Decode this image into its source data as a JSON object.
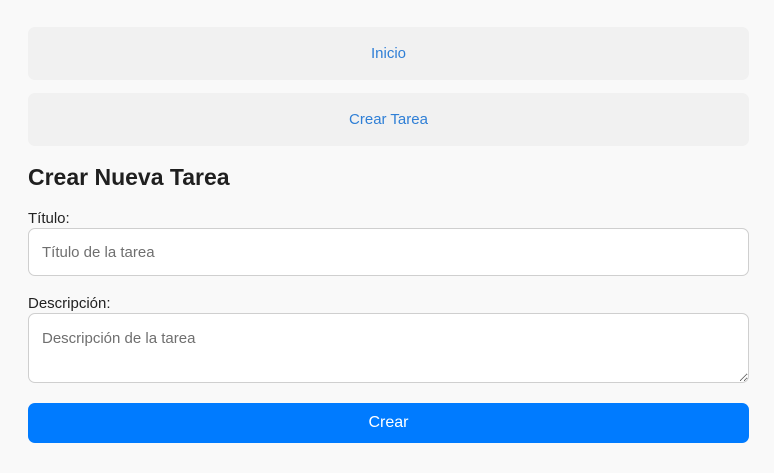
{
  "nav": {
    "home_label": "Inicio",
    "create_label": "Crear Tarea"
  },
  "form": {
    "heading": "Crear Nueva Tarea",
    "title_label": "Título:",
    "title_placeholder": "Título de la tarea",
    "title_value": "",
    "description_label": "Descripción:",
    "description_placeholder": "Descripción de la tarea",
    "description_value": "",
    "submit_label": "Crear"
  },
  "colors": {
    "link": "#2f7fd6",
    "primary": "#007bff",
    "nav_background": "#f1f1f1",
    "page_background": "#f9f9f9"
  }
}
